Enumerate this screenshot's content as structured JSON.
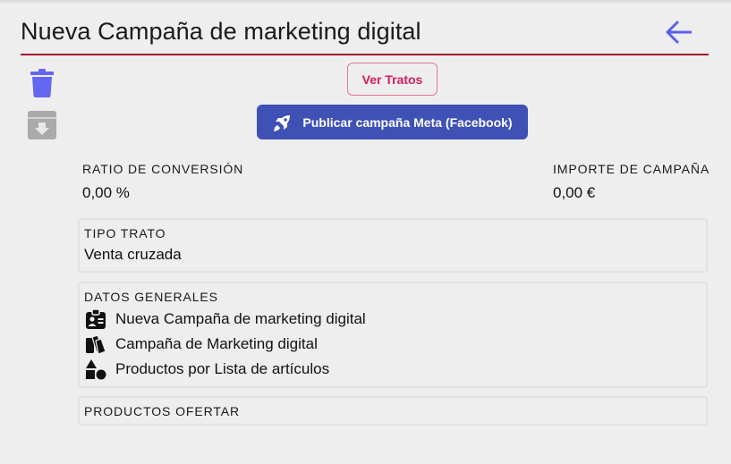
{
  "header": {
    "title": "Nueva Campaña de marketing digital",
    "back_icon": "arrow-left-icon",
    "accent_color": "#a2122c"
  },
  "sidebar": {
    "delete_icon": "trash-icon",
    "archive_icon": "archive-download-icon"
  },
  "actions": {
    "ver_tratos_label": "Ver Tratos",
    "publish_meta_label": "Publicar campaña Meta (Facebook)",
    "publish_icon": "rocket-icon",
    "primary_color": "#3f51b5",
    "secondary_color": "#d81b5c"
  },
  "stats": {
    "conversion_label": "RATIO DE CONVERSIÓN",
    "conversion_value": "0,00 %",
    "amount_label": "IMPORTE DE CAMPAÑA",
    "amount_value": "0,00 €"
  },
  "tipo_trato": {
    "label": "TIPO TRATO",
    "value": "Venta cruzada"
  },
  "datos_generales": {
    "label": "DATOS GENERALES",
    "items": [
      {
        "icon": "id-badge-icon",
        "text": "Nueva Campaña de marketing digital"
      },
      {
        "icon": "swatchbook-icon",
        "text": "Campaña de Marketing digital"
      },
      {
        "icon": "shapes-icon",
        "text": "Productos por Lista de artículos"
      }
    ]
  },
  "productos": {
    "label": "PRODUCTOS OFERTAR"
  }
}
